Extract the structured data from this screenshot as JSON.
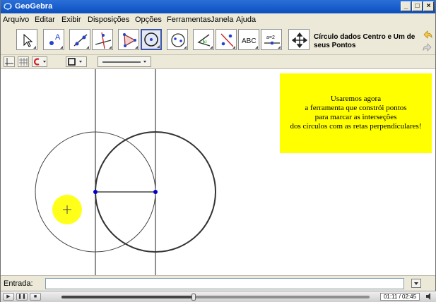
{
  "window": {
    "title": "GeoGebra",
    "controls": [
      "_",
      "□",
      "×"
    ]
  },
  "menu": [
    "Arquivo",
    "Editar",
    "Exibir",
    "Disposições",
    "Opções",
    "Ferramentas",
    "Janela",
    "Ajuda"
  ],
  "toolbar": {
    "tools": [
      {
        "name": "move",
        "icon": "pointer-arrow-icon"
      },
      {
        "name": "new-point",
        "icon": "point-A-icon",
        "text": "A"
      },
      {
        "name": "line",
        "icon": "line-through-points-icon"
      },
      {
        "name": "perpendicular-line",
        "icon": "perpendicular-line-icon"
      },
      {
        "name": "polygon",
        "icon": "polygon-icon"
      },
      {
        "name": "circle-center-point",
        "icon": "circle-center-point-icon",
        "selected": true
      },
      {
        "name": "ellipse",
        "icon": "ellipse-icon"
      },
      {
        "name": "angle",
        "icon": "angle-icon"
      },
      {
        "name": "reflect",
        "icon": "reflect-line-icon"
      },
      {
        "name": "text",
        "icon": "text-abc-icon",
        "text": "ABC"
      },
      {
        "name": "slider",
        "icon": "slider-icon",
        "text": "a=2"
      },
      {
        "name": "move-graphics",
        "icon": "move-graphics-view-icon"
      }
    ],
    "tool_description": "Círculo dados Centro e Um de seus Pontos"
  },
  "stylebar": {
    "items": [
      "axes-toggle-icon",
      "grid-toggle-icon",
      "color-picker-icon",
      "point-style-icon",
      "line-style-icon"
    ]
  },
  "canvas": {
    "note_lines": [
      "Usaremos agora",
      "a ferramenta que constrói pontos",
      "para marcar as interseções",
      "dos círculos com as retas perpendiculares!"
    ],
    "colors": {
      "note_bg": "#ffff00",
      "point": "#0000cc",
      "cursor_highlight": "#ffff00"
    }
  },
  "input_bar": {
    "label": "Entrada:",
    "value": "",
    "help_icon": "input-help-icon"
  },
  "player": {
    "buttons": [
      "rewind-icon",
      "pause-icon",
      "stop-icon"
    ],
    "time": "01:11 / 02:45",
    "progress": 0.43
  }
}
